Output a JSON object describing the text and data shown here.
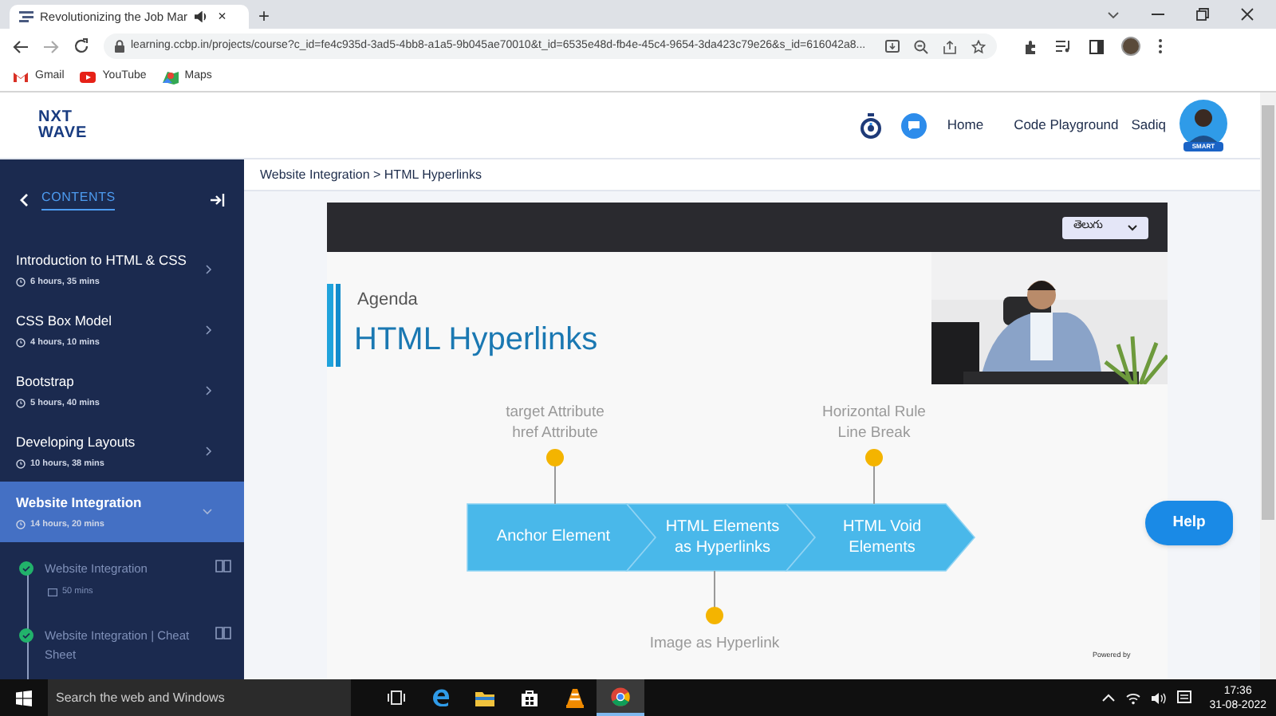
{
  "browser": {
    "tab": {
      "title": "Revolutionizing the Job Mar",
      "close": "×"
    },
    "new_tab": "+",
    "url": "learning.ccbp.in/projects/course?c_id=fe4c935d-3ad5-4bb8-a1a5-9b045ae70010&t_id=6535e48d-fb4e-45c4-9654-3da423c79e26&s_id=616042a8...",
    "bookmarks": [
      {
        "label": "Gmail",
        "kind": "mail"
      },
      {
        "label": "YouTube",
        "kind": "video"
      },
      {
        "label": "Maps",
        "kind": "map"
      }
    ]
  },
  "header": {
    "logo": [
      "NXT",
      "WAVE"
    ],
    "nav": [
      "Home",
      "Code Playground"
    ],
    "user_name": "Sadiq",
    "avatar_badge": "SMART"
  },
  "sidebar": {
    "title": "CONTENTS",
    "courses": [
      {
        "title": "Introduction to HTML & CSS",
        "duration": "6 hours, 35 mins",
        "selected": false,
        "expanded": false
      },
      {
        "title": "CSS Box Model",
        "duration": "4 hours, 10 mins",
        "selected": false,
        "expanded": false
      },
      {
        "title": "Bootstrap",
        "duration": "5 hours, 40 mins",
        "selected": false,
        "expanded": false
      },
      {
        "title": "Developing Layouts",
        "duration": "10 hours, 38 mins",
        "selected": false,
        "expanded": false
      },
      {
        "title": "Website Integration",
        "duration": "14 hours, 20 mins",
        "selected": true,
        "expanded": true
      }
    ],
    "topics": [
      {
        "title": "Website Integration",
        "duration": "50 mins",
        "completed": true
      },
      {
        "title": "Website Integration | Cheat Sheet",
        "completed": true
      }
    ]
  },
  "breadcrumb": "Website Integration > HTML Hyperlinks",
  "video": {
    "language": "తెలుగు",
    "slide": {
      "eyebrow": "Agenda",
      "title": "HTML Hyperlinks",
      "steps": [
        {
          "lines": [
            "Anchor Element"
          ],
          "callout": {
            "kind": "above",
            "lines": [
              "target Attribute",
              "href Attribute"
            ]
          }
        },
        {
          "lines": [
            "HTML Elements",
            "as Hyperlinks"
          ],
          "callout": {
            "kind": "below",
            "lines": [
              "Image as Hyperlink"
            ]
          }
        },
        {
          "lines": [
            "HTML Void",
            "Elements"
          ],
          "callout": {
            "kind": "above",
            "lines": [
              "Horizontal Rule",
              "Line Break"
            ]
          }
        }
      ]
    },
    "powered_by": "Powered by"
  },
  "help_button": "Help",
  "taskbar": {
    "search": "Search the web and Windows",
    "time": "17:36",
    "date": "31-08-2022"
  }
}
